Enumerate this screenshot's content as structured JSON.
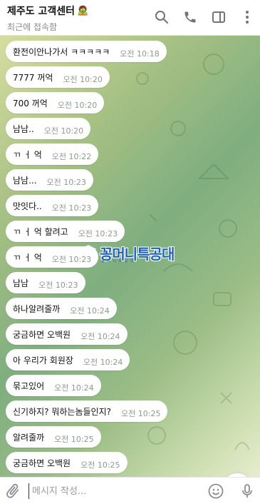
{
  "header": {
    "title": "제주도 고객센터",
    "title_emoji": "🧟",
    "subtitle": "최근에 접속함",
    "icons": [
      "search-icon",
      "phone-icon",
      "sidebar-icon",
      "more-vertical-icon"
    ]
  },
  "messages": [
    {
      "text": "환전이안나가서 ㅋㅋㅋㅋㅋ",
      "time": "오전 10:18"
    },
    {
      "text": "7777 꺼억",
      "time": "오전 10:20"
    },
    {
      "text": "700 꺼억",
      "time": "오전 10:20"
    },
    {
      "text": "남남..",
      "time": "오전 10:20"
    },
    {
      "text": "ㄲ ㅓ 억",
      "time": "오전 10:22"
    },
    {
      "text": "남남...",
      "time": "오전 10:23"
    },
    {
      "text": "맛잇다..",
      "time": "오전 10:23"
    },
    {
      "text": "ㄲ ㅓ 억 할려고",
      "time": "오전 10:23"
    },
    {
      "text": "ㄲ ㅓ 억",
      "time": "오전 10:23"
    },
    {
      "text": "남남",
      "time": "오전 10:23"
    },
    {
      "text": "하나알려줄까",
      "time": "오전 10:24"
    },
    {
      "text": "궁금하면 오백원",
      "time": "오전 10:24"
    },
    {
      "text": "아 우리가 회원장",
      "time": "오전 10:24"
    },
    {
      "text": "묶고있어",
      "time": "오전 10:24"
    },
    {
      "text": "신기하지? 뭐하는놈들인지?",
      "time": "오전 10:25"
    },
    {
      "text": "알려줄까",
      "time": "오전 10:25"
    },
    {
      "text": "궁금하면 오백원",
      "time": "오전 10:25"
    }
  ],
  "watermark": {
    "text": "꽁머니특공대",
    "subtext": "꽁 머 니 특 공 대"
  },
  "composer": {
    "placeholder": "메시지 작성...",
    "value": ""
  },
  "colors": {
    "accent": "#1f63b8",
    "bubble": "#ffffff",
    "time": "#8e9a8e"
  }
}
